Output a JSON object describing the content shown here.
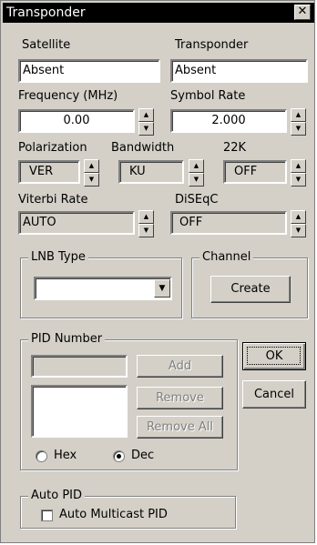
{
  "window": {
    "title": "Transponder",
    "close_glyph": "✕"
  },
  "satellite": {
    "label": "Satellite",
    "value": "Absent"
  },
  "transponder": {
    "label": "Transponder",
    "value": "Absent"
  },
  "frequency": {
    "label": "Frequency (MHz)",
    "value": "0.00"
  },
  "symbol_rate": {
    "label": "Symbol Rate",
    "value": "2.000"
  },
  "polarization": {
    "label": "Polarization",
    "value": "VER"
  },
  "bandwidth": {
    "label": "Bandwidth",
    "value": "KU"
  },
  "tone22k": {
    "label": "22K",
    "value": "OFF"
  },
  "viterbi": {
    "label": "Viterbi Rate",
    "value": "AUTO"
  },
  "diseqc": {
    "label": "DiSEqC",
    "value": "OFF"
  },
  "lnb": {
    "label": "LNB Type",
    "value": ""
  },
  "channel": {
    "label": "Channel",
    "create_label": "Create"
  },
  "pid": {
    "label": "PID Number",
    "add_label": "Add",
    "remove_label": "Remove",
    "remove_all_label": "Remove All",
    "hex_label": "Hex",
    "dec_label": "Dec",
    "selected": "Dec"
  },
  "auto_pid": {
    "label": "Auto PID",
    "checkbox_label": "Auto Multicast PID",
    "checked": false
  },
  "buttons": {
    "ok_label": "OK",
    "cancel_label": "Cancel"
  },
  "icons": {
    "spin_up": "▲",
    "spin_down": "▼",
    "dropdown": "▼"
  }
}
